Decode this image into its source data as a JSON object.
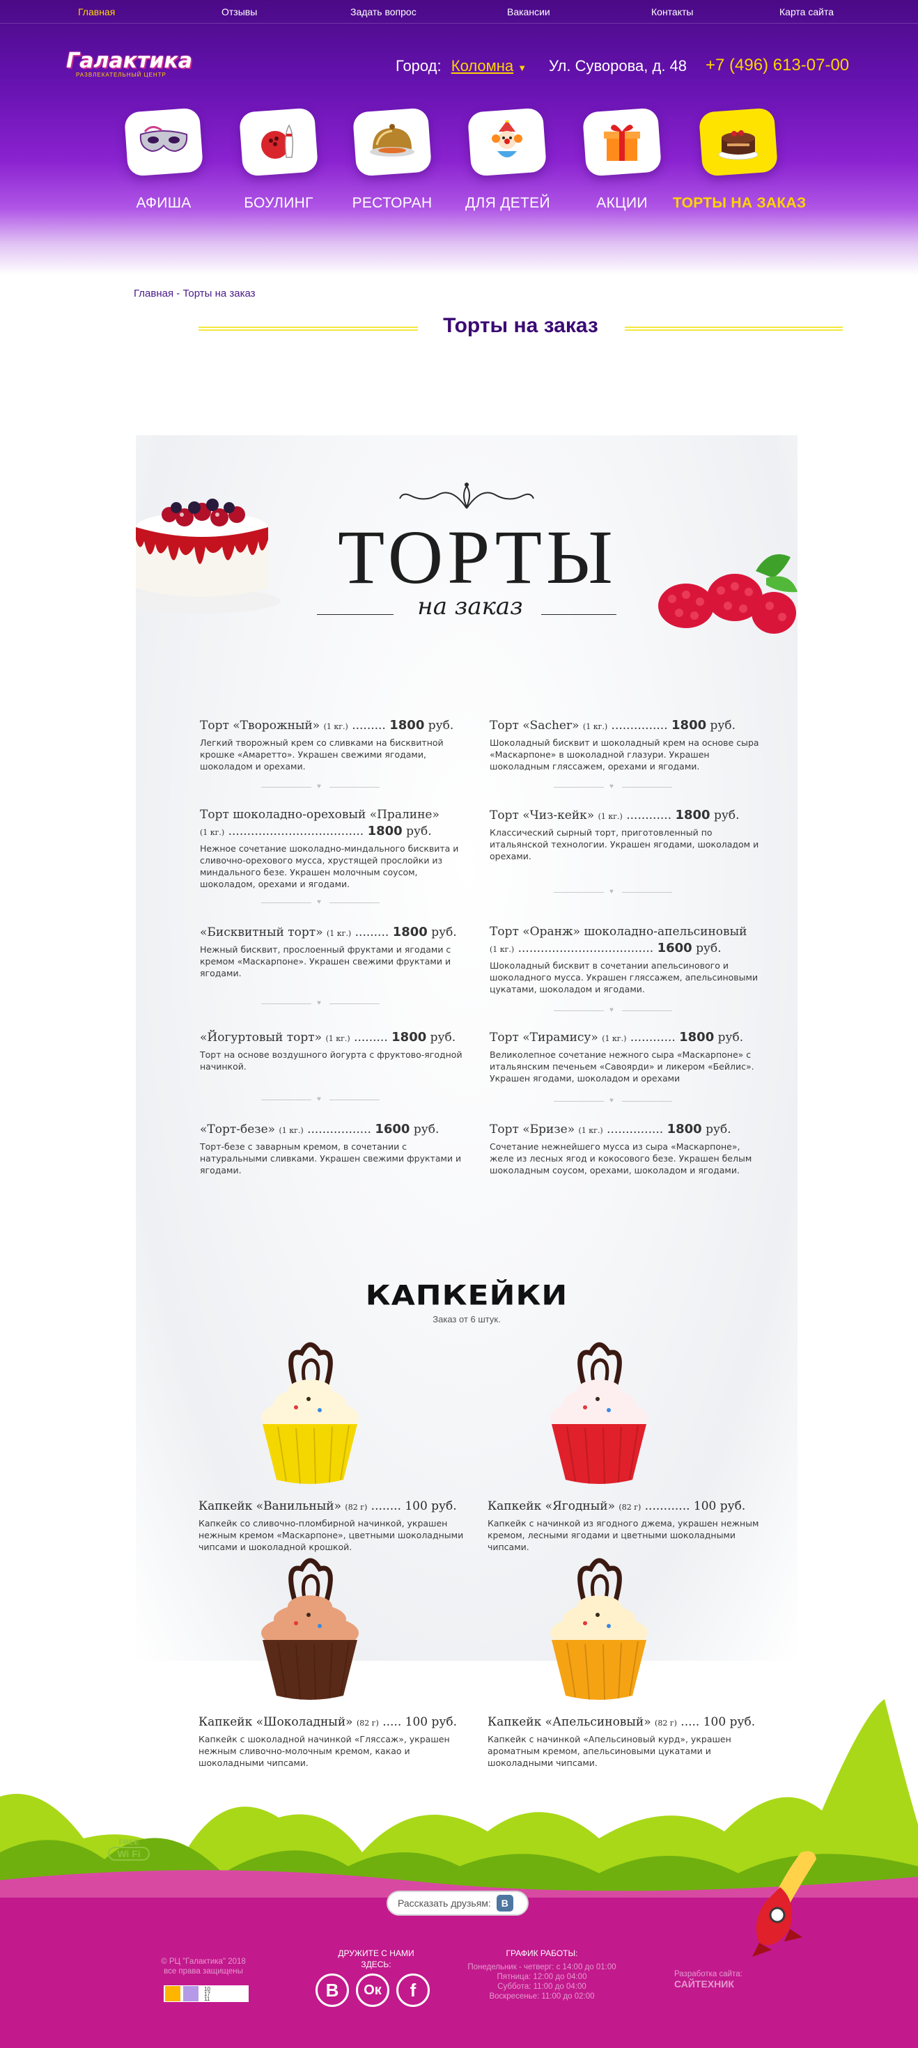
{
  "topnav": [
    "Главная",
    "Отзывы",
    "Задать вопрос",
    "Вакансии",
    "Контакты",
    "Карта сайта"
  ],
  "logo": {
    "name": "Галактика",
    "tagline": "РАЗВЛЕКАТЕЛЬНЫЙ ЦЕНТР"
  },
  "contacts": {
    "city_label": "Город:",
    "city": "Коломна",
    "address": "Ул. Суворова, д. 48",
    "phone": "+7 (496) 613-07-00"
  },
  "categories": [
    {
      "label": "АФИША",
      "icon": "masquerade-mask-icon"
    },
    {
      "label": "БОУЛИНГ",
      "icon": "bowling-icon"
    },
    {
      "label": "РЕСТОРАН",
      "icon": "cloche-dish-icon"
    },
    {
      "label": "ДЛЯ ДЕТЕЙ",
      "icon": "clown-icon"
    },
    {
      "label": "АКЦИИ",
      "icon": "gift-box-icon"
    },
    {
      "label": "ТОРТЫ НА ЗАКАЗ",
      "icon": "cake-icon",
      "active": true
    }
  ],
  "breadcrumb": {
    "home": "Главная",
    "separator": " - ",
    "current": "Торты на заказ"
  },
  "page_title": "Торты на заказ",
  "hero": {
    "title": "ТОРТЫ",
    "subtitle": "на заказ"
  },
  "cakes": [
    {
      "name": "Торт «Творожный»",
      "weight": "(1 кг.)",
      "dots": " .........",
      "price": "1800",
      "unit": " руб.",
      "desc": "Легкий творожный крем со сливками на бисквитной крошке «Амаретто». Украшен свежими ягодами, шоколадом и орехами."
    },
    {
      "name": "Торт «Sacher»",
      "weight": "(1 кг.)",
      "dots": " ...............",
      "price": "1800",
      "unit": " руб.",
      "desc": "Шоколадный бисквит и шоколадный крем на основе сыра «Маскарпоне» в шоколадной глазури. Украшен шоколадным гляссажем, орехами и ягодами."
    },
    {
      "name": "Торт шоколадно-ореховый «Пралине»",
      "weight": "(1 кг.)",
      "dots": " ....................................",
      "price": "1800",
      "unit": " руб.",
      "desc": "Нежное сочетание шоколадно-миндального бисквита и сливочно-орехового мусса, хрустящей прослойки из миндального безе. Украшен молочным соусом, шоколадом, орехами и ягодами."
    },
    {
      "name": "Торт «Чиз-кейк»",
      "weight": "(1 кг.)",
      "dots": " ............",
      "price": "1800",
      "unit": " руб.",
      "desc": "Классический сырный торт, приготовленный по итальянской технологии. Украшен ягодами, шоколадом и орехами."
    },
    {
      "name": "«Бисквитный торт»",
      "weight": "(1 кг.)",
      "dots": " .........",
      "price": "1800",
      "unit": " руб.",
      "desc": "Нежный бисквит, прослоенный фруктами и ягодами с кремом «Маскарпоне». Украшен свежими фруктами и ягодами."
    },
    {
      "name": "Торт «Оранж» шоколадно-апельсиновый",
      "weight": "(1 кг.)",
      "dots": " ....................................",
      "price": "1600",
      "unit": " руб.",
      "desc": "Шоколадный бисквит в сочетании апельсинового и шоколадного мусса. Украшен гляссажем, апельсиновыми цукатами, шоколадом и ягодами."
    },
    {
      "name": "«Йогуртовый торт»",
      "weight": "(1 кг.)",
      "dots": " .........",
      "price": "1800",
      "unit": " руб.",
      "desc": "Торт на основе воздушного йогурта с фруктово-ягодной начинкой."
    },
    {
      "name": "Торт «Тирамису»",
      "weight": "(1 кг.)",
      "dots": " ............",
      "price": "1800",
      "unit": " руб.",
      "desc": "Великолепное сочетание нежного сыра «Маскарпоне» с итальянским печеньем «Савоярди» и ликером «Бейлис». Украшен ягодами, шоколадом и орехами"
    },
    {
      "name": "«Торт-безе»",
      "weight": "(1 кг.)",
      "dots": " .................",
      "price": "1600",
      "unit": " руб.",
      "desc": "Торт-безе с заварным кремом, в сочетании с натуральными сливками. Украшен свежими фруктами и ягодами."
    },
    {
      "name": "Торт «Бризе»",
      "weight": "(1 кг.)",
      "dots": " ...............",
      "price": "1800",
      "unit": " руб.",
      "desc": "Сочетание нежнейшего мусса из сыра «Маскарпоне», желе из лесных ягод и кокосового безе. Украшен белым шоколадным соусом, орехами, шоколадом и ягодами."
    }
  ],
  "cupcakes_title": "КАПКЕЙКИ",
  "cupcakes_subtitle": "Заказ от 6 штук.",
  "cupcakes": [
    {
      "name": "Капкейк «Ванильный»",
      "weight": "(82 г)",
      "dots": " ........",
      "price": "100 руб.",
      "desc": "Капкейк со сливочно-пломбирной начинкой, украшен нежным кремом «Маскарпоне», цветными шоколадными чипсами и шоколадной крошкой.",
      "cup": "#f5d700",
      "cream": "#fff6da"
    },
    {
      "name": "Капкейк «Ягодный»",
      "weight": "(82 г)",
      "dots": " ............",
      "price": "100 руб.",
      "desc": "Капкейк с начинкой из ягодного джема, украшен нежным кремом, лесными ягодами и цветными шоколадными чипсами.",
      "cup": "#e0202a",
      "cream": "#fdeff0"
    },
    {
      "name": "Капкейк «Шоколадный»",
      "weight": "(82 г)",
      "dots": " .....",
      "price": "100 руб.",
      "desc": "Капкейк с шоколадной начинкой «Гляссаж», украшен нежным сливочно-молочным кремом, какао и шоколадными чипсами.",
      "cup": "#5a2a18",
      "cream": "#e8a07a"
    },
    {
      "name": "Капкейк «Апельсиновый»",
      "weight": "(82 г)",
      "dots": " .....",
      "price": "100 руб.",
      "desc": "Капкейк с начинкой «Апельсиновый курд», украшен ароматным кремом, апельсиновыми цукатами и шоколадными чипсами.",
      "cup": "#f6a313",
      "cream": "#fff1cc"
    }
  ],
  "footer": {
    "share_label": "Рассказать друзьям:",
    "wifi_free": "FREE",
    "wifi": "Wi Fi",
    "copyright": "© РЦ \"Галактика\" 2018",
    "rights": "все права защищены",
    "social_title": "ДРУЖИТЕ С НАМИ",
    "social_title2": "ЗДЕСЬ:",
    "social": [
      "В",
      "Ок",
      "f"
    ],
    "schedule_title": "ГРАФИК РАБОТЫ:",
    "schedule": [
      "Понедельник - четверг: с 14:00 до 01:00",
      "Пятница: 12:00 до 04:00",
      "Суббота: 11:00 до 04:00",
      "Воскресенье: 11:00 до 02:00"
    ],
    "dev_label": "Разработка сайта:",
    "dev": "САЙТЕХНИК",
    "counter": [
      "10",
      "17",
      "11"
    ]
  },
  "colors": {
    "purple": "#5c0fa8",
    "yellow": "#ffd400",
    "magenta": "#c2198c",
    "green": "#a8d414"
  }
}
